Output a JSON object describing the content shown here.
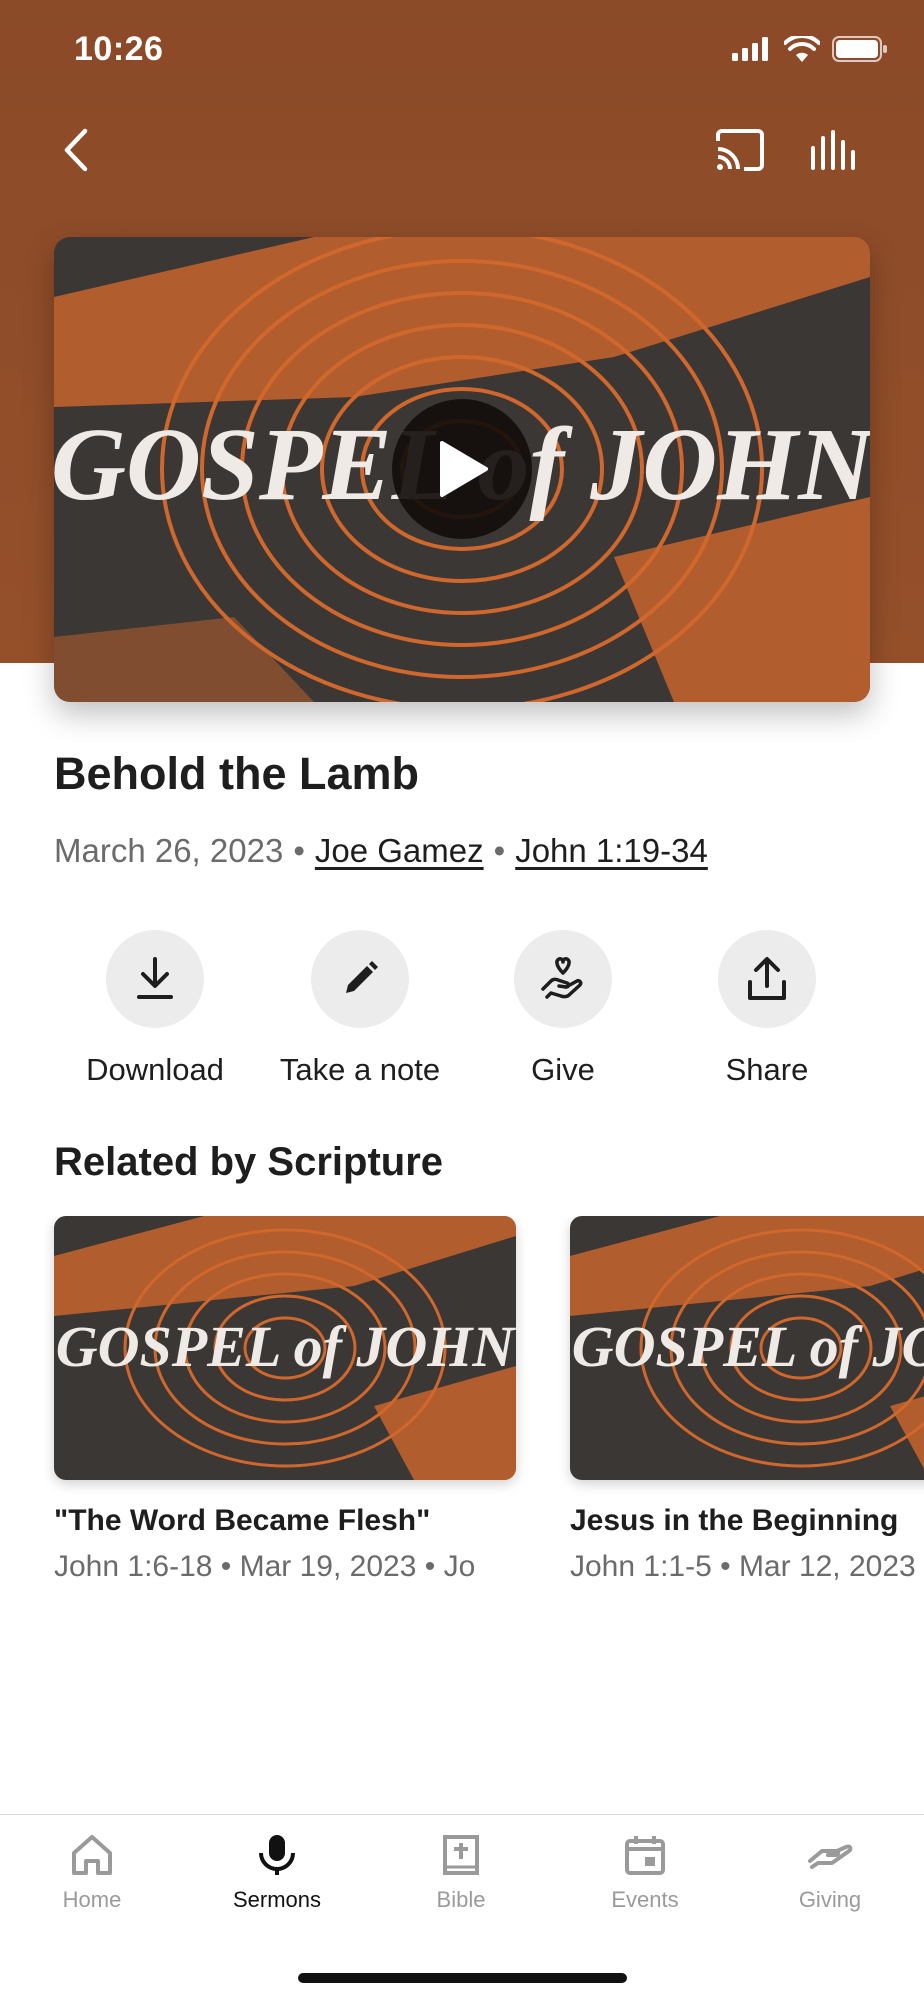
{
  "status_bar": {
    "time": "10:26"
  },
  "nav": {
    "back_icon": "chevron-left-icon",
    "cast_icon": "cast-icon",
    "audio_icon": "audio-bars-icon"
  },
  "hero": {
    "artwork_text": "GOSPEL of JOHN",
    "play_icon": "play-icon"
  },
  "sermon": {
    "title": "Behold the Lamb",
    "date": "March 26, 2023",
    "speaker": "Joe Gamez",
    "scripture": "John 1:19-34"
  },
  "actions": [
    {
      "label": "Download",
      "icon": "download-icon"
    },
    {
      "label": "Take a note",
      "icon": "pencil-icon"
    },
    {
      "label": "Give",
      "icon": "give-hand-heart-icon"
    },
    {
      "label": "Share",
      "icon": "share-icon"
    }
  ],
  "related": {
    "heading": "Related by Scripture",
    "items": [
      {
        "title": "\"The Word Became Flesh\"",
        "meta": "John 1:6-18 • Mar 19, 2023 • Jo"
      },
      {
        "title": "Jesus in the Beginning",
        "meta": "John 1:1-5 • Mar 12, 2023"
      }
    ]
  },
  "tabs": [
    {
      "label": "Home",
      "icon": "home-icon",
      "active": false
    },
    {
      "label": "Sermons",
      "icon": "microphone-icon",
      "active": true
    },
    {
      "label": "Bible",
      "icon": "bible-icon",
      "active": false
    },
    {
      "label": "Events",
      "icon": "calendar-icon",
      "active": false
    },
    {
      "label": "Giving",
      "icon": "giving-icon",
      "active": false
    }
  ],
  "colors": {
    "header": "#8b4a28",
    "artwork_orange": "#c8642c",
    "artwork_dark": "#3a3735",
    "text_primary": "#1e1e1e",
    "text_secondary": "#6b6b6b"
  }
}
